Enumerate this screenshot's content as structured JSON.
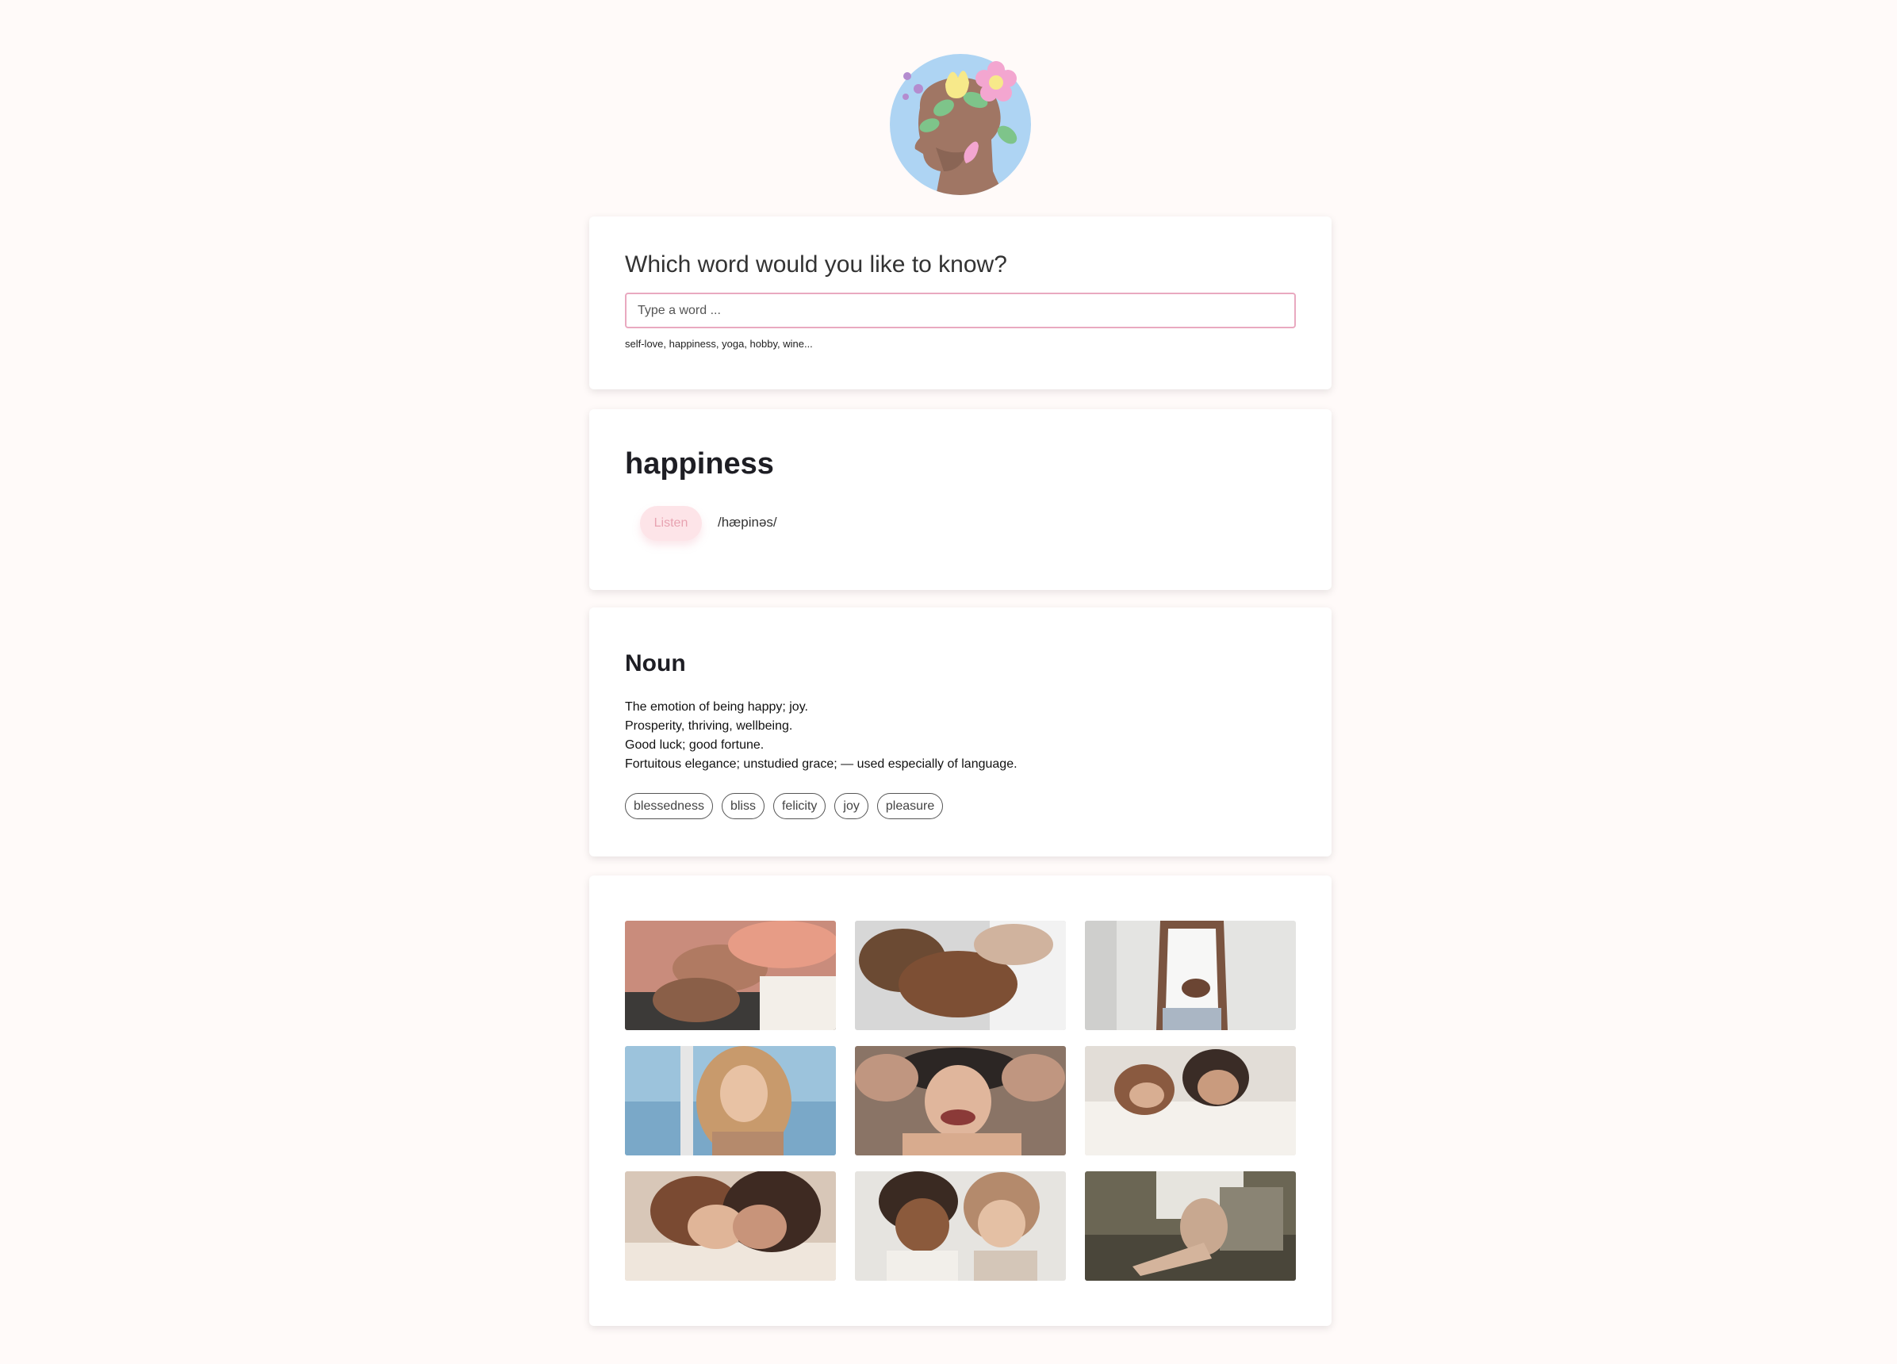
{
  "search": {
    "title": "Which word would you like to know?",
    "placeholder": "Type a word ...",
    "hint": "self-love, happiness, yoga, hobby, wine..."
  },
  "word": {
    "title": "happiness",
    "listen_label": "Listen",
    "phonetic": "/hæpinəs/"
  },
  "meaning": {
    "part_of_speech": "Noun",
    "definitions": [
      "The emotion of being happy; joy.",
      "Prosperity, thriving, wellbeing.",
      "Good luck; good fortune.",
      "Fortuitous elegance; unstudied grace; — used especially of language."
    ],
    "synonyms": [
      "blessedness",
      "bliss",
      "felicity",
      "joy",
      "pleasure"
    ]
  },
  "colors": {
    "background": "#fffaf9",
    "accent_pink": "#e9a9c0",
    "listen_bg": "#fde4e8",
    "listen_text": "#e8a3b1"
  },
  "icons": {
    "logo": "head-with-flowers-icon"
  }
}
